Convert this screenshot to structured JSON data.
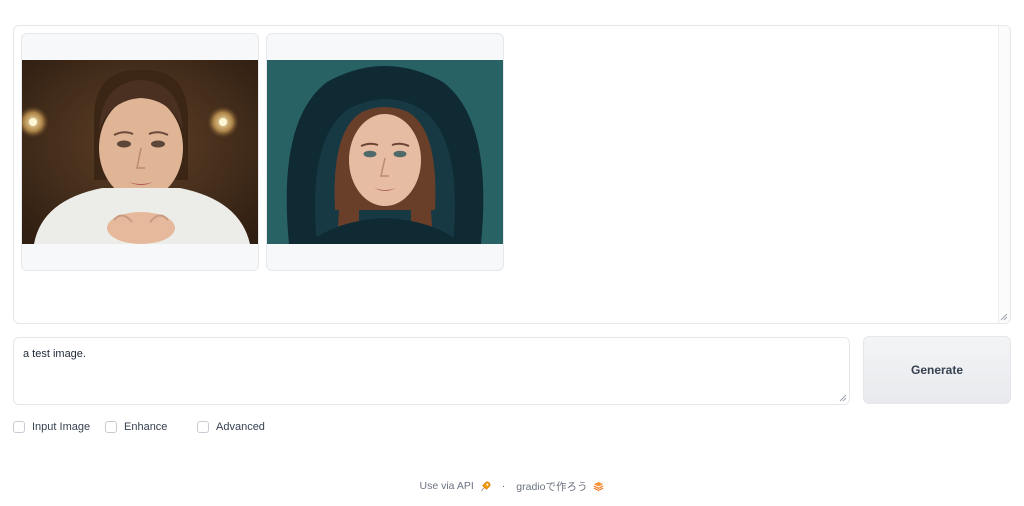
{
  "gallery": {
    "images": [
      {
        "alt": "woman-in-white-blouse-portrait"
      },
      {
        "alt": "woman-in-dark-hood-portrait"
      }
    ]
  },
  "prompt": {
    "value": "a test image."
  },
  "generate": {
    "label": "Generate"
  },
  "options": [
    {
      "label": "Input Image",
      "checked": false
    },
    {
      "label": "Enhance",
      "checked": false
    },
    {
      "label": "Advanced",
      "checked": false
    }
  ],
  "footer": {
    "api_label": "Use via API",
    "separator": "·",
    "built_with": "gradioで作ろう"
  }
}
